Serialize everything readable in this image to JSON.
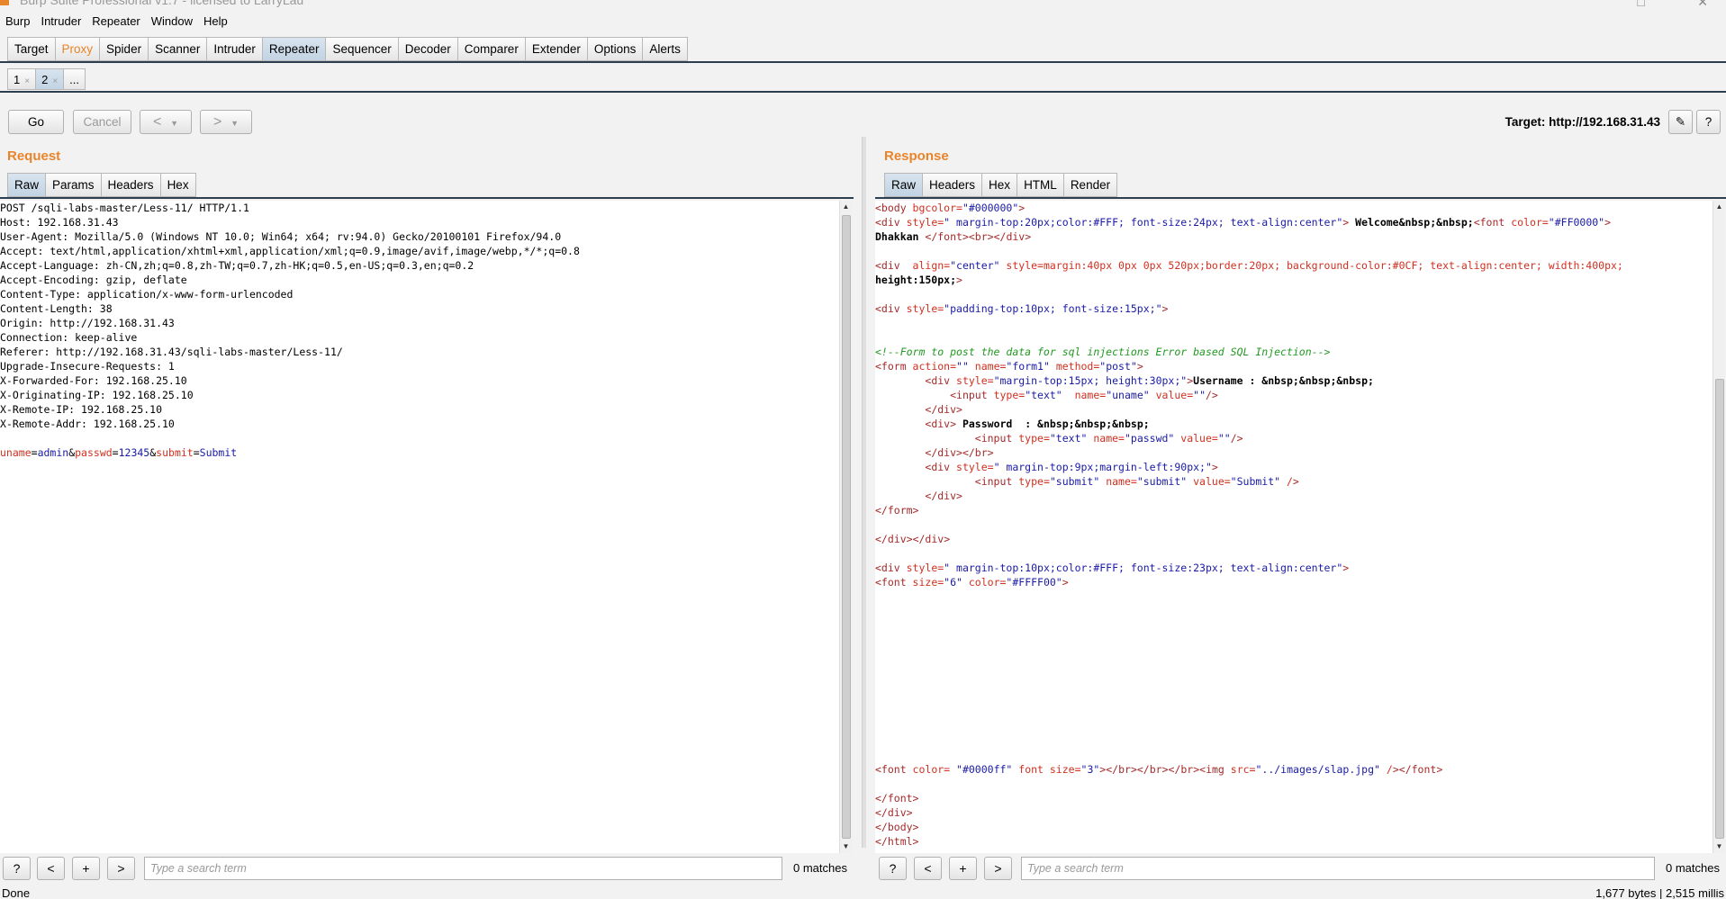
{
  "window": {
    "title": "Burp Suite Professional v1.7 - licensed to LarryLau"
  },
  "menu": [
    "Burp",
    "Intruder",
    "Repeater",
    "Window",
    "Help"
  ],
  "main_tabs": [
    "Target",
    "Proxy",
    "Spider",
    "Scanner",
    "Intruder",
    "Repeater",
    "Sequencer",
    "Decoder",
    "Comparer",
    "Extender",
    "Options",
    "Alerts"
  ],
  "repeater_tabs": [
    {
      "label": "1",
      "close": "×"
    },
    {
      "label": "2",
      "close": "×"
    },
    {
      "label": "..."
    }
  ],
  "toolbar": {
    "go": "Go",
    "cancel": "Cancel",
    "back": "<",
    "forward": ">",
    "dropdown": "▼",
    "target_label": "Target: http://192.168.31.43",
    "edit_icon": "✎",
    "help_icon": "?"
  },
  "request": {
    "title": "Request",
    "tabs": [
      "Raw",
      "Params",
      "Headers",
      "Hex"
    ],
    "lines": [
      "POST /sqli-labs-master/Less-11/ HTTP/1.1",
      "Host: 192.168.31.43",
      "User-Agent: Mozilla/5.0 (Windows NT 10.0; Win64; x64; rv:94.0) Gecko/20100101 Firefox/94.0",
      "Accept: text/html,application/xhtml+xml,application/xml;q=0.9,image/avif,image/webp,*/*;q=0.8",
      "Accept-Language: zh-CN,zh;q=0.8,zh-TW;q=0.7,zh-HK;q=0.5,en-US;q=0.3,en;q=0.2",
      "Accept-Encoding: gzip, deflate",
      "Content-Type: application/x-www-form-urlencoded",
      "Content-Length: 38",
      "Origin: http://192.168.31.43",
      "Connection: keep-alive",
      "Referer: http://192.168.31.43/sqli-labs-master/Less-11/",
      "Upgrade-Insecure-Requests: 1",
      "X-Forwarded-For: 192.168.25.10",
      "X-Originating-IP: 192.168.25.10",
      "X-Remote-IP: 192.168.25.10",
      "X-Remote-Addr: 192.168.25.10",
      ""
    ],
    "body_params": [
      {
        "name": "uname",
        "value": "admin"
      },
      {
        "name": "passwd",
        "value": "12345"
      },
      {
        "name": "submit",
        "value": "Submit"
      }
    ],
    "search_placeholder": "Type a search term",
    "matches": "0 matches"
  },
  "response": {
    "title": "Response",
    "tabs": [
      "Raw",
      "Headers",
      "Hex",
      "HTML",
      "Render"
    ],
    "lines": [
      "<body bgcolor=\"#000000\">",
      "<div style=\" margin-top:20px;color:#FFF; font-size:24px; text-align:center\"> Welcome&nbsp;&nbsp;<font color=\"#FF0000\">",
      "Dhakkan </font><br></div>",
      "",
      "<div  align=\"center\" style=\"margin:40px 0px 0px 520px;border:20px; background-color:#0CF; text-align:center; width:400px;",
      "height:150px;\">",
      "",
      "<div style=\"padding-top:10px; font-size:15px;\">",
      "",
      "",
      "<!--Form to post the data for sql injections Error based SQL Injection-->",
      "<form action=\"\" name=\"form1\" method=\"post\">",
      "\t<div style=\"margin-top:15px; height:30px;\">Username : &nbsp;&nbsp;&nbsp;",
      "\t    <input type=\"text\"  name=\"uname\" value=\"\"/>",
      "\t</div>",
      "\t<div> Password  : &nbsp;&nbsp;&nbsp;",
      "\t\t<input type=\"text\" name=\"passwd\" value=\"\"/>",
      "\t</div></br>",
      "\t<div style=\" margin-top:9px;margin-left:90px;\">",
      "\t\t<input type=\"submit\" name=\"submit\" value=\"Submit\" />",
      "\t</div>",
      "</form>",
      "",
      "</div></div>",
      "",
      "<div style=\" margin-top:10px;color:#FFF; font-size:23px; text-align:center\">",
      "<font size=\"6\" color=\"#FFFF00\">",
      "",
      "",
      "",
      "",
      "",
      "",
      "",
      "",
      "",
      "",
      "",
      "",
      "<font color= \"#0000ff\" font size=\"3\"></br></br></br><img src=\"../images/slap.jpg\" /></font>",
      "",
      "</font>",
      "</div>",
      "</body>",
      "</html>"
    ],
    "search_placeholder": "Type a search term",
    "matches": "0 matches"
  },
  "search_buttons": [
    "?",
    "<",
    "+",
    ">"
  ],
  "status": {
    "left": "Done",
    "right": "1,677 bytes | 2,515 millis"
  },
  "colors": {
    "accent_orange": "#e8852b",
    "dark_rule": "#2d3e50",
    "tab_active": "#c2d3e3"
  }
}
